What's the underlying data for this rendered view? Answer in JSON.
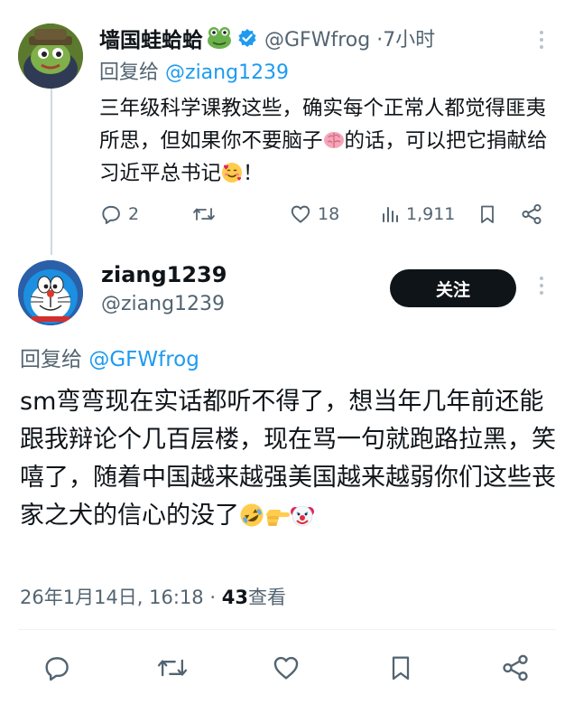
{
  "reply_tweet": {
    "author_name": "墙国蛙蛤蛤",
    "author_handle": "@GFWfrog",
    "separator": "·",
    "time_ago": "7小时",
    "reply_prefix": "回复给",
    "reply_to": "@ziang1239",
    "body_part1": "三年级科学课教这些，确实每个正常人都觉得匪夷所思，但如果你不要脑子",
    "body_part2": "的话，可以把它捐献给习近平总书记",
    "body_part3": "！",
    "emojis": [
      "frog-emoji",
      "brain-emoji",
      "smiling-face-with-hearts-emoji"
    ],
    "actions": {
      "replies": "2",
      "retweets": "",
      "likes": "18",
      "views": "1,911"
    }
  },
  "main_tweet": {
    "author_name": "ziang1239",
    "author_handle": "@ziang1239",
    "follow_label": "关注",
    "reply_prefix": "回复给",
    "reply_to": "@GFWfrog",
    "body": "sm弯弯现在实话都听不得了，想当年几年前还能跟我辩论个几百层楼，现在骂一句就跑路拉黑，笑嘻了，随着中国越来越强美国越来越弱你们这些丧家之犬的信心的没了",
    "emojis": [
      "rolling-on-floor-laughing-emoji",
      "backhand-index-pointing-right-emoji",
      "clown-face-emoji"
    ],
    "date": "26年1月14日, 16:18 ·",
    "views_count": "43",
    "views_label": "查看"
  },
  "colors": {
    "text_primary": "#0f1419",
    "text_secondary": "#536471",
    "accent_blue": "#1d9bf0",
    "follow_button_bg": "#0f1419",
    "divider": "#eff3f4"
  },
  "icons": [
    "reply-icon",
    "retweet-icon",
    "like-icon",
    "views-icon",
    "bookmark-icon",
    "share-icon",
    "more-icon",
    "verified-badge-icon"
  ]
}
